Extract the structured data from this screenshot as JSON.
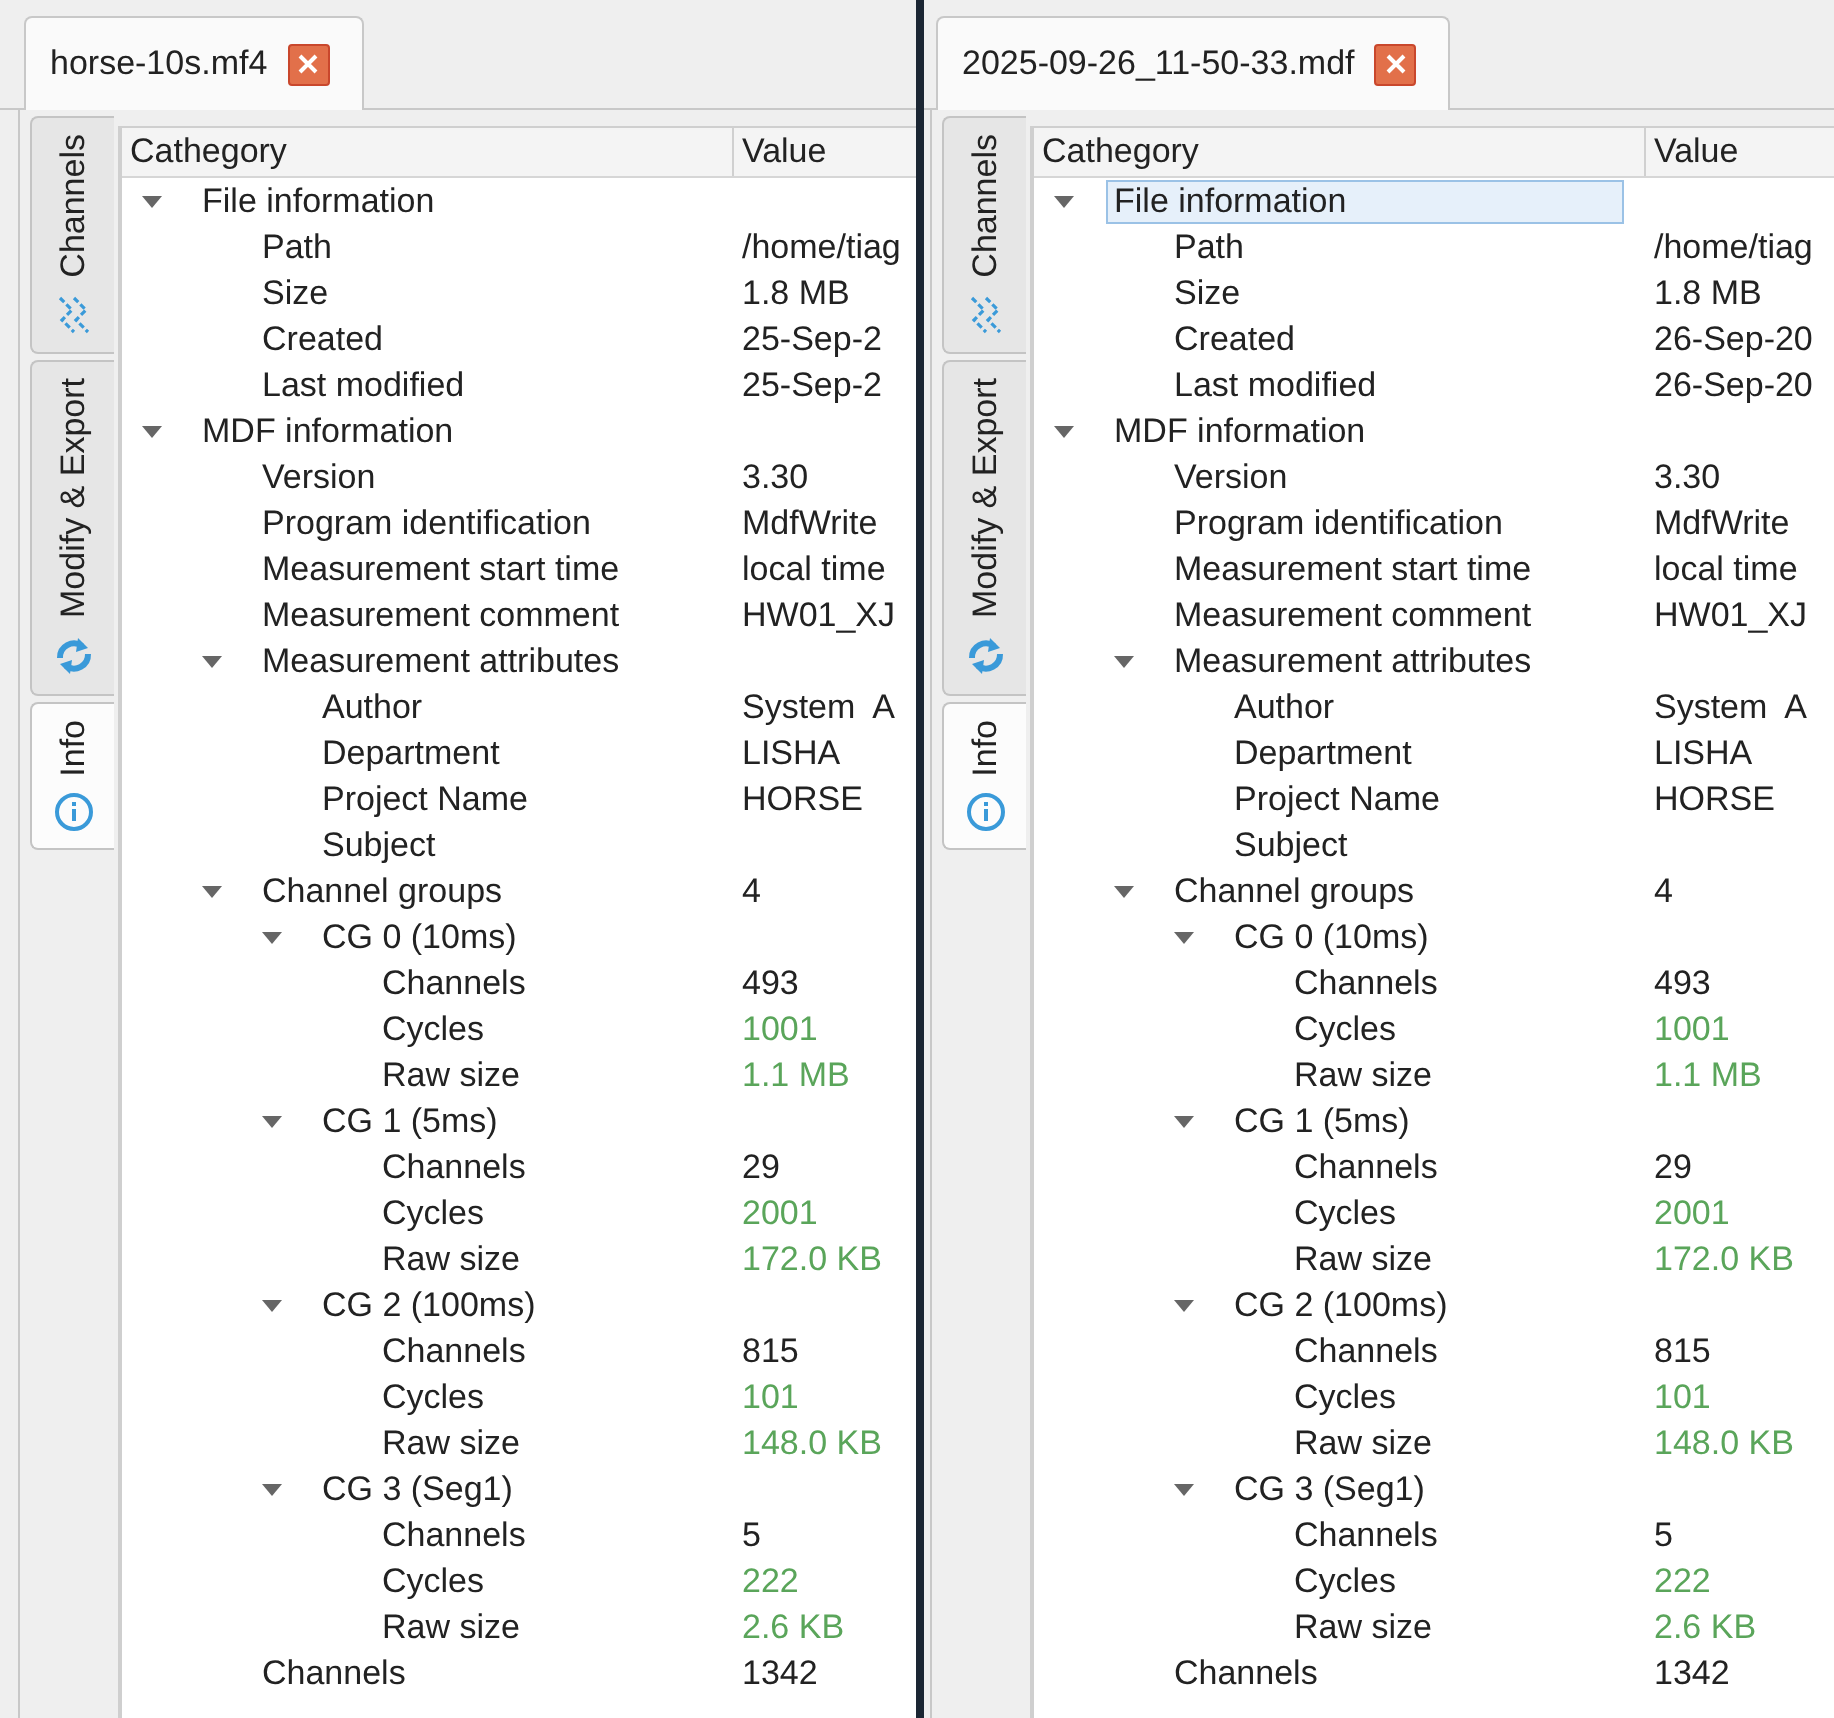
{
  "panes": [
    {
      "tab": {
        "title": "horse-10s.mf4"
      },
      "side_tabs": [
        {
          "label": "Channels",
          "kind": "channels",
          "selected": false
        },
        {
          "label": "Modify & Export",
          "kind": "modify",
          "selected": false
        },
        {
          "label": "Info",
          "kind": "info",
          "selected": true
        }
      ],
      "tree": {
        "columns": [
          "Cathegory",
          "Value"
        ],
        "items": [
          {
            "label": "File information",
            "expanded": true,
            "selected": false,
            "children": [
              {
                "label": "Path",
                "value": "/home/tiag",
                "selected": false
              },
              {
                "label": "Size",
                "value": "1.8 MB",
                "selected": false
              },
              {
                "label": "Created",
                "value": "25-Sep-2",
                "selected": false
              },
              {
                "label": "Last modified",
                "value": "25-Sep-2",
                "selected": false
              }
            ]
          },
          {
            "label": "MDF information",
            "expanded": true,
            "selected": false,
            "children": [
              {
                "label": "Version",
                "value": "3.30",
                "selected": false
              },
              {
                "label": "Program identification",
                "value": "MdfWrite",
                "selected": false
              },
              {
                "label": "Measurement start time",
                "value": "local time",
                "selected": false
              },
              {
                "label": "Measurement comment",
                "value": "HW01_XJ",
                "selected": false
              },
              {
                "label": "Measurement attributes",
                "expanded": true,
                "selected": false,
                "children": [
                  {
                    "label": "Author",
                    "value": "System  A",
                    "selected": false
                  },
                  {
                    "label": "Department",
                    "value": "LISHA",
                    "selected": false
                  },
                  {
                    "label": "Project Name",
                    "value": "HORSE",
                    "selected": false
                  },
                  {
                    "label": "Subject",
                    "selected": false
                  }
                ]
              },
              {
                "label": "Channel groups",
                "value": "4",
                "expanded": true,
                "selected": false,
                "children": [
                  {
                    "label": "CG 0 (10ms)",
                    "expanded": true,
                    "selected": false,
                    "children": [
                      {
                        "label": "Channels",
                        "value": "493",
                        "selected": false
                      },
                      {
                        "label": "Cycles",
                        "value": "1001",
                        "color": "#5aa55a",
                        "selected": false
                      },
                      {
                        "label": "Raw size",
                        "value": "1.1 MB",
                        "color": "#5aa55a",
                        "selected": false
                      }
                    ]
                  },
                  {
                    "label": "CG 1 (5ms)",
                    "expanded": true,
                    "selected": false,
                    "children": [
                      {
                        "label": "Channels",
                        "value": "29",
                        "selected": false
                      },
                      {
                        "label": "Cycles",
                        "value": "2001",
                        "color": "#5aa55a",
                        "selected": false
                      },
                      {
                        "label": "Raw size",
                        "value": "172.0 KB",
                        "color": "#5aa55a",
                        "selected": false
                      }
                    ]
                  },
                  {
                    "label": "CG 2 (100ms)",
                    "expanded": true,
                    "selected": false,
                    "children": [
                      {
                        "label": "Channels",
                        "value": "815",
                        "selected": false
                      },
                      {
                        "label": "Cycles",
                        "value": "101",
                        "color": "#5aa55a",
                        "selected": false
                      },
                      {
                        "label": "Raw size",
                        "value": "148.0 KB",
                        "color": "#5aa55a",
                        "selected": false
                      }
                    ]
                  },
                  {
                    "label": "CG 3 (Seg1)",
                    "expanded": true,
                    "selected": false,
                    "children": [
                      {
                        "label": "Channels",
                        "value": "5",
                        "selected": false
                      },
                      {
                        "label": "Cycles",
                        "value": "222",
                        "color": "#5aa55a",
                        "selected": false
                      },
                      {
                        "label": "Raw size",
                        "value": "2.6 KB",
                        "color": "#5aa55a",
                        "selected": false
                      }
                    ]
                  }
                ]
              },
              {
                "label": "Channels",
                "value": "1342",
                "selected": false
              }
            ]
          }
        ]
      }
    },
    {
      "tab": {
        "title": "2025-09-26_11-50-33.mdf"
      },
      "side_tabs": [
        {
          "label": "Channels",
          "kind": "channels",
          "selected": false
        },
        {
          "label": "Modify & Export",
          "kind": "modify",
          "selected": false
        },
        {
          "label": "Info",
          "kind": "info",
          "selected": true
        }
      ],
      "tree": {
        "columns": [
          "Cathegory",
          "Value"
        ],
        "items": [
          {
            "label": "File information",
            "expanded": true,
            "selected": true,
            "children": [
              {
                "label": "Path",
                "value": "/home/tiag",
                "selected": false
              },
              {
                "label": "Size",
                "value": "1.8 MB",
                "selected": false
              },
              {
                "label": "Created",
                "value": "26-Sep-20",
                "selected": false
              },
              {
                "label": "Last modified",
                "value": "26-Sep-20",
                "selected": false
              }
            ]
          },
          {
            "label": "MDF information",
            "expanded": true,
            "selected": false,
            "children": [
              {
                "label": "Version",
                "value": "3.30",
                "selected": false
              },
              {
                "label": "Program identification",
                "value": "MdfWrite",
                "selected": false
              },
              {
                "label": "Measurement start time",
                "value": "local time",
                "selected": false
              },
              {
                "label": "Measurement comment",
                "value": "HW01_XJ",
                "selected": false
              },
              {
                "label": "Measurement attributes",
                "expanded": true,
                "selected": false,
                "children": [
                  {
                    "label": "Author",
                    "value": "System  A",
                    "selected": false
                  },
                  {
                    "label": "Department",
                    "value": "LISHA",
                    "selected": false
                  },
                  {
                    "label": "Project Name",
                    "value": "HORSE",
                    "selected": false
                  },
                  {
                    "label": "Subject",
                    "selected": false
                  }
                ]
              },
              {
                "label": "Channel groups",
                "value": "4",
                "expanded": true,
                "selected": false,
                "children": [
                  {
                    "label": "CG 0 (10ms)",
                    "expanded": true,
                    "selected": false,
                    "children": [
                      {
                        "label": "Channels",
                        "value": "493",
                        "selected": false
                      },
                      {
                        "label": "Cycles",
                        "value": "1001",
                        "color": "#5aa55a",
                        "selected": false
                      },
                      {
                        "label": "Raw size",
                        "value": "1.1 MB",
                        "color": "#5aa55a",
                        "selected": false
                      }
                    ]
                  },
                  {
                    "label": "CG 1 (5ms)",
                    "expanded": true,
                    "selected": false,
                    "children": [
                      {
                        "label": "Channels",
                        "value": "29",
                        "selected": false
                      },
                      {
                        "label": "Cycles",
                        "value": "2001",
                        "color": "#5aa55a",
                        "selected": false
                      },
                      {
                        "label": "Raw size",
                        "value": "172.0 KB",
                        "color": "#5aa55a",
                        "selected": false
                      }
                    ]
                  },
                  {
                    "label": "CG 2 (100ms)",
                    "expanded": true,
                    "selected": false,
                    "children": [
                      {
                        "label": "Channels",
                        "value": "815",
                        "selected": false
                      },
                      {
                        "label": "Cycles",
                        "value": "101",
                        "color": "#5aa55a",
                        "selected": false
                      },
                      {
                        "label": "Raw size",
                        "value": "148.0 KB",
                        "color": "#5aa55a",
                        "selected": false
                      }
                    ]
                  },
                  {
                    "label": "CG 3 (Seg1)",
                    "expanded": true,
                    "selected": false,
                    "children": [
                      {
                        "label": "Channels",
                        "value": "5",
                        "selected": false
                      },
                      {
                        "label": "Cycles",
                        "value": "222",
                        "color": "#5aa55a",
                        "selected": false
                      },
                      {
                        "label": "Raw size",
                        "value": "2.6 KB",
                        "color": "#5aa55a",
                        "selected": false
                      }
                    ]
                  }
                ]
              },
              {
                "label": "Channels",
                "value": "1342",
                "selected": false
              }
            ]
          }
        ]
      }
    }
  ]
}
